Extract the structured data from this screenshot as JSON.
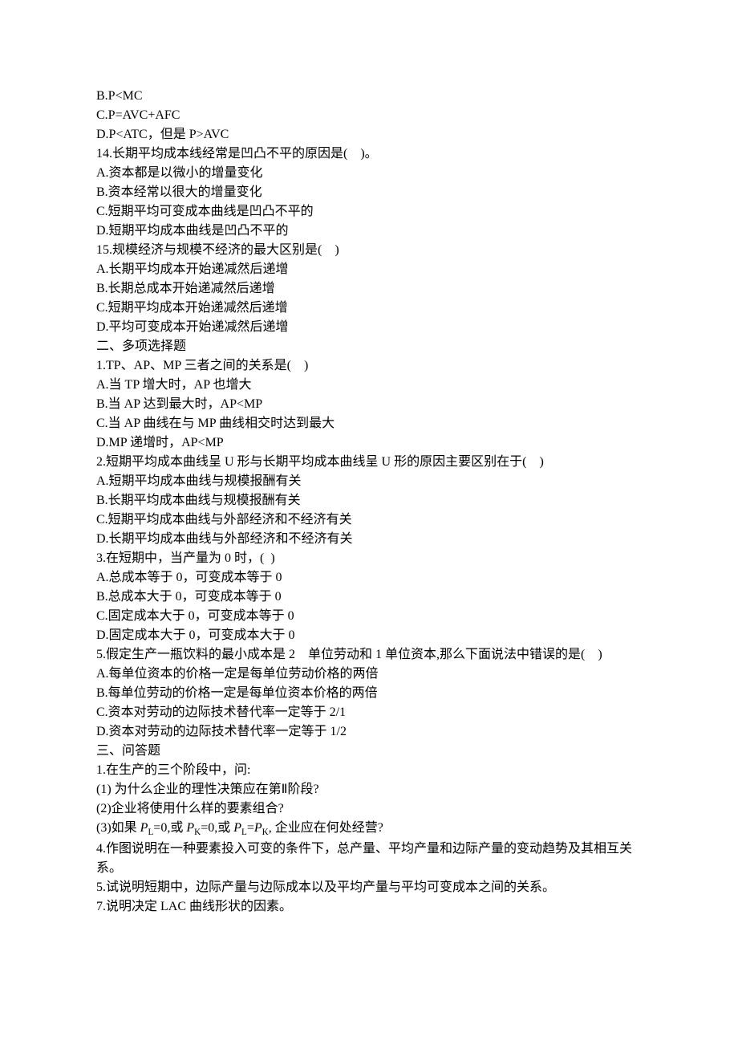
{
  "lines": [
    {
      "t": "B.P<MC"
    },
    {
      "t": "C.P=AVC+AFC"
    },
    {
      "t": "D.P<ATC，但是 P>AVC"
    },
    {
      "t": "14.长期平均成本线经常是凹凸不平的原因是(　)。"
    },
    {
      "t": "A.资本都是以微小的增量变化"
    },
    {
      "t": "B.资本经常以很大的增量变化"
    },
    {
      "t": "C.短期平均可变成本曲线是凹凸不平的"
    },
    {
      "t": "D.短期平均成本曲线是凹凸不平的"
    },
    {
      "t": "15.规模经济与规模不经济的最大区别是(　)"
    },
    {
      "t": "A.长期平均成本开始递减然后递增"
    },
    {
      "t": "B.长期总成本开始递减然后递增"
    },
    {
      "t": "C.短期平均成本开始递减然后递增"
    },
    {
      "t": "D.平均可变成本开始递减然后递增"
    },
    {
      "t": "二、多项选择题"
    },
    {
      "t": "1.TP、AP、MP 三者之间的关系是(　)"
    },
    {
      "t": "A.当 TP 增大时，AP 也增大"
    },
    {
      "t": "B.当 AP 达到最大时，AP<MP"
    },
    {
      "t": "C.当 AP 曲线在与 MP 曲线相交时达到最大"
    },
    {
      "t": "D.MP 递增时，AP<MP"
    },
    {
      "t": "2.短期平均成本曲线呈 U 形与长期平均成本曲线呈 U 形的原因主要区别在于(　)"
    },
    {
      "t": "A.短期平均成本曲线与规模报酬有关"
    },
    {
      "t": "B.长期平均成本曲线与规模报酬有关"
    },
    {
      "t": "C.短期平均成本曲线与外部经济和不经济有关"
    },
    {
      "t": "D.长期平均成本曲线与外部经济和不经济有关"
    },
    {
      "t": "3.在短期中，当产量为 0 时，(  )"
    },
    {
      "t": "A.总成本等于 0，可变成本等于 0"
    },
    {
      "t": "B.总成本大于 0，可变成本等于 0"
    },
    {
      "t": "C.固定成本大于 0，可变成本等于 0"
    },
    {
      "t": "D.固定成本大于 0，可变成本大于 0"
    },
    {
      "t": "5.假定生产一瓶饮料的最小成本是 2　单位劳动和 1 单位资本,那么下面说法中错误的是(　)"
    },
    {
      "t": "A.每单位资本的价格一定是每单位劳动价格的两倍"
    },
    {
      "t": "B.每单位劳动的价格一定是每单位资本价格的两倍"
    },
    {
      "t": "C.资本对劳动的边际技术替代率一定等于 2/1"
    },
    {
      "t": "D.资本对劳动的边际技术替代率一定等于 1/2"
    },
    {
      "t": "三、问答题"
    },
    {
      "t": "1.在生产的三个阶段中，问:"
    },
    {
      "t": "(1) 为什么企业的理性决策应在第Ⅱ阶段?"
    },
    {
      "t": "(2)企业将使用什么样的要素组合?"
    },
    {
      "html": "(3)如果 <i>P</i><span class=\"sub\">L</span>=0,或 <i>P</i><span class=\"sub\">K</span>=0,或 <i>P</i><span class=\"sub\">L</span>=<i>P</i><span class=\"sub\">K</span>, 企业应在何处经营?"
    },
    {
      "t": "4.作图说明在一种要素投入可变的条件下，总产量、平均产量和边际产量的变动趋势及其相互关系。"
    },
    {
      "t": "5.试说明短期中，边际产量与边际成本以及平均产量与平均可变成本之间的关系。"
    },
    {
      "t": "7.说明决定 LAC 曲线形状的因素。"
    }
  ]
}
